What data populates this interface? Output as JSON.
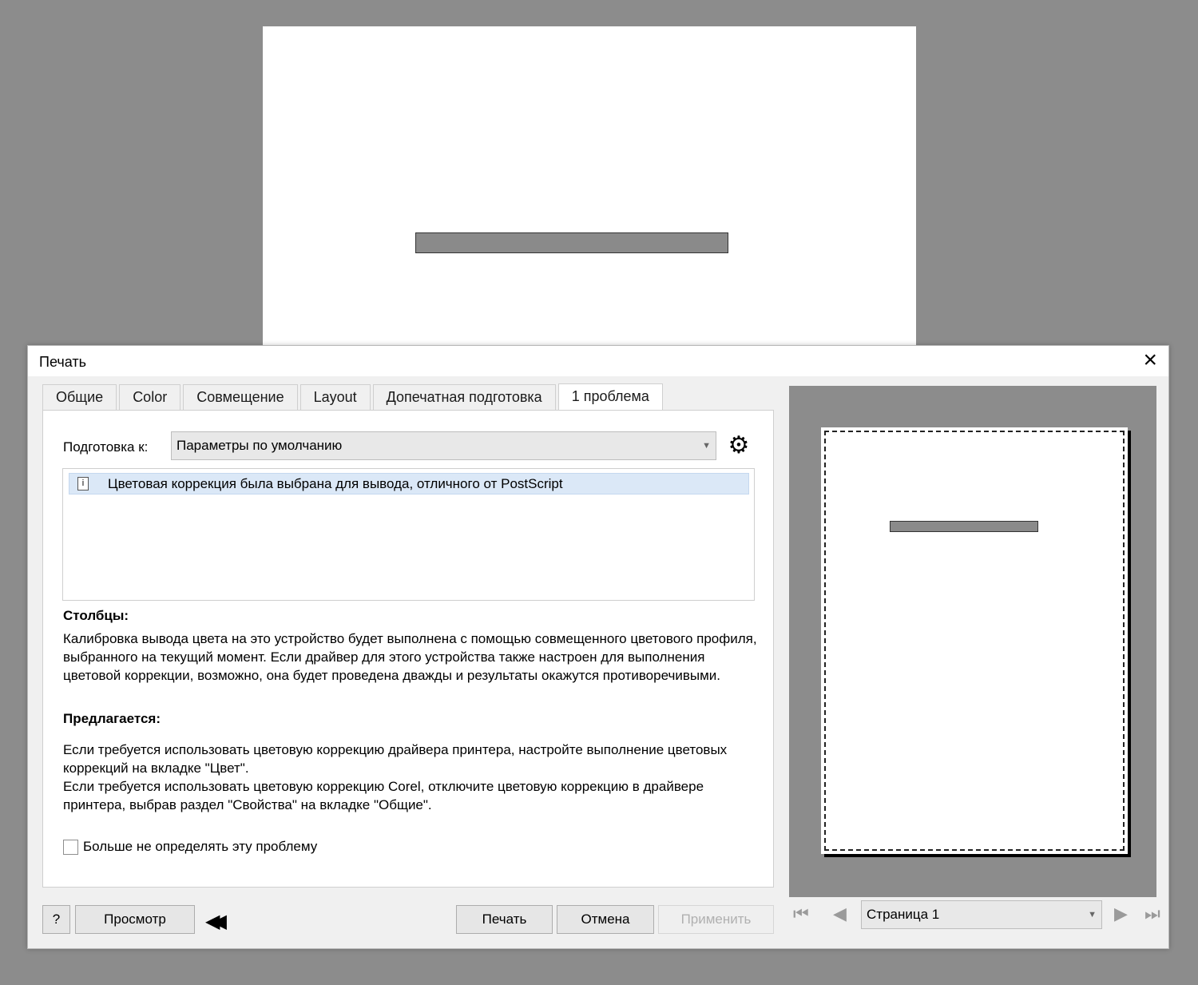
{
  "dialog": {
    "title": "Печать",
    "close_icon": "×"
  },
  "tabs": [
    {
      "label": "Общие"
    },
    {
      "label": "Color"
    },
    {
      "label": "Совмещение"
    },
    {
      "label": "Layout"
    },
    {
      "label": "Допечатная подготовка"
    },
    {
      "label": "1 проблема"
    }
  ],
  "issues": {
    "prepare_label": "Подготовка к:",
    "prepare_value": "Параметры по умолчанию",
    "settings_icon": "gear-icon",
    "list": [
      {
        "text": "Цветовая коррекция была выбрана для вывода, отличного от PostScript",
        "icon": "document-icon"
      }
    ],
    "columns_heading": "Столбцы:",
    "columns_text": "Калибровка вывода цвета на это устройство будет выполнена с помощью совмещенного цветового профиля, выбранного на текущий момент. Если драйвер для этого устройства также настроен для выполнения цветовой коррекции, возможно, она будет проведена дважды и результаты окажутся противоречивыми.",
    "suggest_heading": "Предлагается:",
    "suggest_line1": "Если требуется использовать цветовую коррекцию драйвера принтера, настройте выполнение цветовых коррекций на вкладке \"Цвет\".",
    "suggest_line2": "Если требуется использовать цветовую коррекцию Corel, отключите цветовую коррекцию в драйвере принтера, выбрав раздел \"Свойства\" на вкладке \"Общие\".",
    "dont_check_label": "Больше не определять эту проблему",
    "dont_check_checked": false
  },
  "footer": {
    "help_label": "?",
    "preview_label": "Просмотр",
    "print_label": "Печать",
    "cancel_label": "Отмена",
    "apply_label": "Применить"
  },
  "preview_nav": {
    "page_value": "Страница 1"
  }
}
